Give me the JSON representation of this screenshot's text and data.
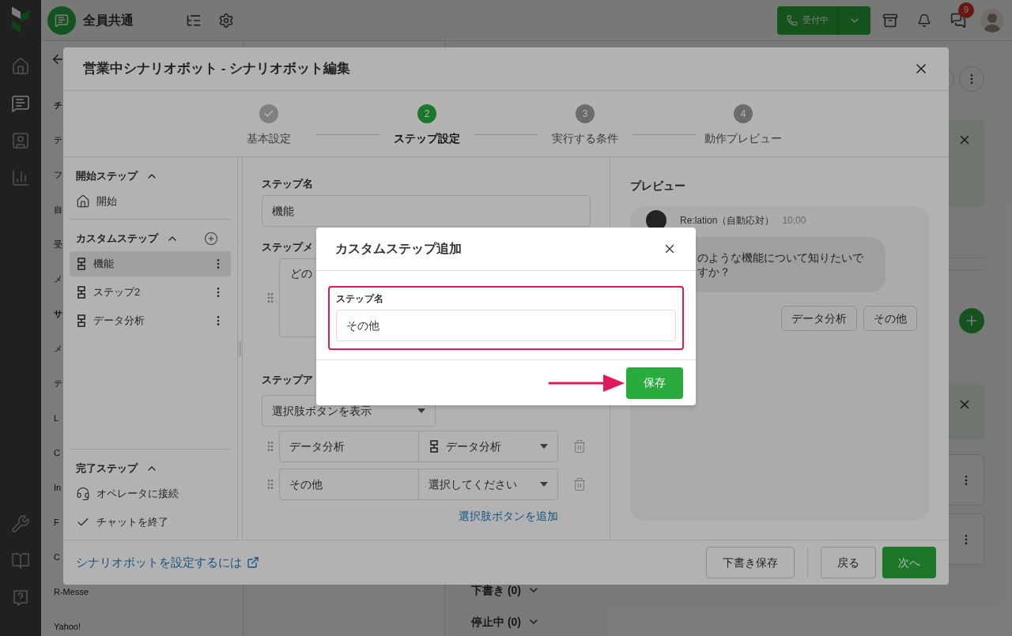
{
  "nav": {
    "items": [
      {
        "selected": false
      },
      {
        "selected": true
      },
      {
        "selected": false
      },
      {
        "selected": false
      }
    ]
  },
  "topbar": {
    "inbox_name": "全員共通",
    "status_button": "受付中",
    "notification_count": "9"
  },
  "background": {
    "list": [
      {
        "kind": "heading",
        "text": "チ"
      },
      {
        "kind": "item",
        "text": "テ"
      },
      {
        "kind": "item",
        "text": "フ"
      },
      {
        "kind": "item",
        "text": "自"
      },
      {
        "kind": "item",
        "text": "受"
      },
      {
        "kind": "item",
        "text": "メ"
      },
      {
        "kind": "heading",
        "text": "サ"
      },
      {
        "kind": "item",
        "text": "メ"
      },
      {
        "kind": "item",
        "text": "テ"
      },
      {
        "kind": "item",
        "text": "L"
      },
      {
        "kind": "item",
        "text": "C"
      },
      {
        "kind": "item",
        "text": "In"
      },
      {
        "kind": "item",
        "text": "F"
      },
      {
        "kind": "item",
        "text": "C"
      },
      {
        "kind": "item",
        "text": "R-Messe"
      },
      {
        "kind": "item",
        "text": "Yahoo!"
      }
    ],
    "sections": [
      {
        "label": "下書き (0)",
        "expanded": false
      },
      {
        "label": "停止中 (0)",
        "expanded": false
      }
    ]
  },
  "editor": {
    "title": "営業中シナリオボット - シナリオボット編集",
    "steps": [
      {
        "label": "基本設定",
        "completed": true,
        "selected": false
      },
      {
        "label": "ステップ設定",
        "number": "2",
        "completed": false,
        "selected": true
      },
      {
        "label": "実行する条件",
        "number": "3",
        "completed": false,
        "selected": false
      },
      {
        "label": "動作プレビュー",
        "number": "4",
        "completed": false,
        "selected": false
      }
    ],
    "sidebar": {
      "sections": [
        {
          "title": "開始ステップ",
          "expanded": true,
          "can_add": false,
          "items": [
            {
              "label": "開始",
              "kind": "start",
              "selected": false
            }
          ]
        },
        {
          "title": "カスタムステップ",
          "expanded": true,
          "can_add": true,
          "items": [
            {
              "label": "機能",
              "kind": "custom",
              "selected": true
            },
            {
              "label": "ステップ2",
              "kind": "custom",
              "selected": false
            },
            {
              "label": "データ分析",
              "kind": "custom",
              "selected": false
            }
          ]
        },
        {
          "title": "完了ステップ",
          "expanded": true,
          "can_add": false,
          "items": [
            {
              "label": "オペレータに接続",
              "kind": "operator",
              "selected": false
            },
            {
              "label": "チャットを終了",
              "kind": "end",
              "selected": false
            }
          ]
        }
      ]
    },
    "form": {
      "step_name_label": "ステップ名",
      "step_name": "機能",
      "message_label": "ステップメ",
      "message": "どの",
      "action_label": "ステップア",
      "action": "選択肢ボタンを表示",
      "choices": [
        {
          "label": "データ分析",
          "target": "データ分析",
          "linked": true
        },
        {
          "label": "その他",
          "target": "選択してください",
          "linked": false
        }
      ],
      "add_choice": "選択肢ボタンを追加"
    },
    "preview": {
      "title": "プレビュー",
      "sender": "Re:lation（自動応対）",
      "time": "10:00",
      "message_lines": [
        "のような機能について知りたいで",
        "すか？"
      ],
      "choices": [
        "データ分析",
        "その他"
      ]
    },
    "footer": {
      "help_link": "シナリオボットを設定するには",
      "draft_button": "下書き保存",
      "back_button": "戻る",
      "next_button": "次へ"
    }
  },
  "dialog": {
    "title": "カスタムステップ追加",
    "field_label": "ステップ名",
    "value": "その他",
    "save_button": "保存"
  }
}
